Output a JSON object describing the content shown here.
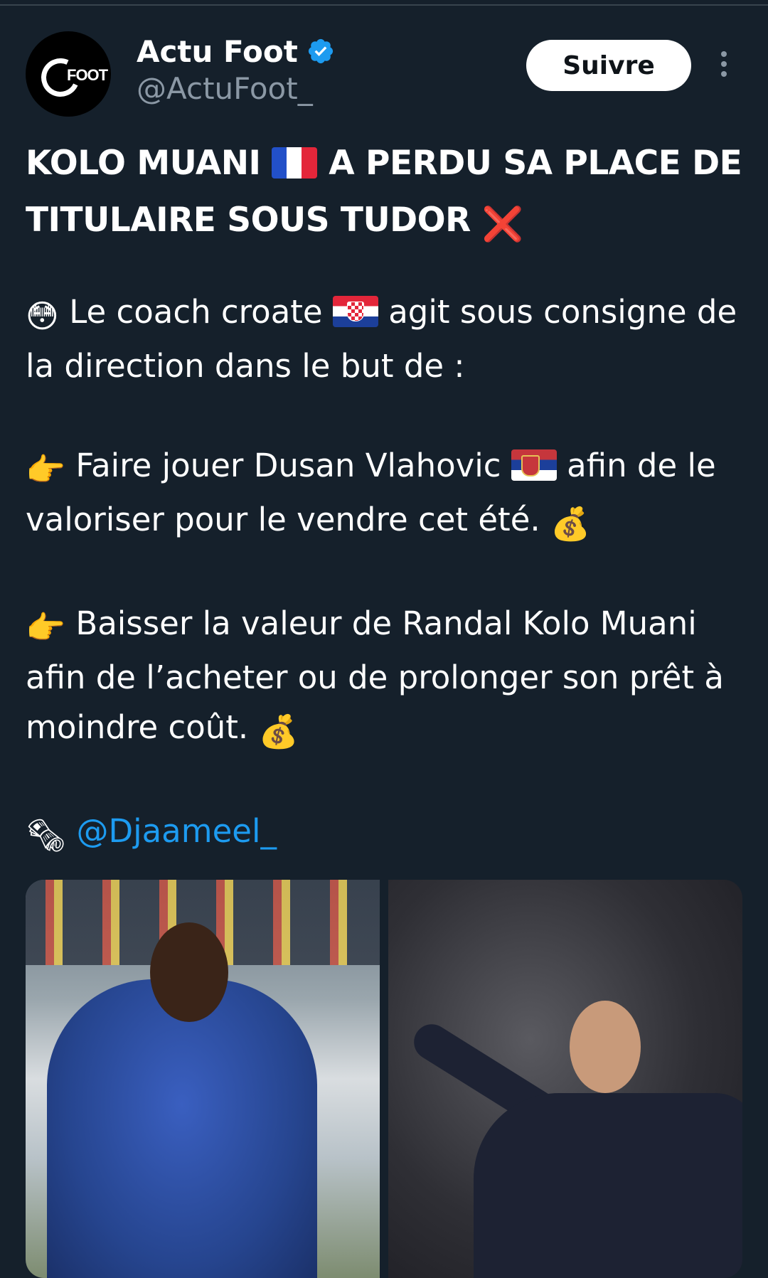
{
  "author": {
    "display_name": "Actu Foot",
    "handle": "@ActuFoot_",
    "avatar_text": "FOOT",
    "verified": true
  },
  "actions": {
    "follow_label": "Suivre"
  },
  "tweet": {
    "headline_part1": "KOLO MUANI",
    "headline_part2": "A PERDU SA PLACE DE TITULAIRE SOUS TUDOR",
    "headline_end_emoji": "❌",
    "intro_emoji": "😳",
    "intro_part1": "Le coach croate",
    "intro_part2": "agit sous consigne de la direction dans le but de :",
    "point_emoji": "👉",
    "point1_part1": "Faire jouer Dusan Vlahovic",
    "point1_part2": "afin de le valoriser pour le vendre cet été.",
    "money_emoji": "💰",
    "point2": "Baisser la valeur de Randal Kolo Muani afin de l’acheter ou de prolonger son prêt à moindre coût.",
    "source_emoji": "🗞",
    "mention": "@Djaameel_"
  },
  "colors": {
    "background": "#15202b",
    "text": "#ffffff",
    "secondary_text": "#8b98a5",
    "link": "#1d9bf0",
    "verified_badge": "#1d9bf0"
  },
  "icons": {
    "verified": "verified-badge-icon",
    "more": "more-vertical-icon"
  }
}
